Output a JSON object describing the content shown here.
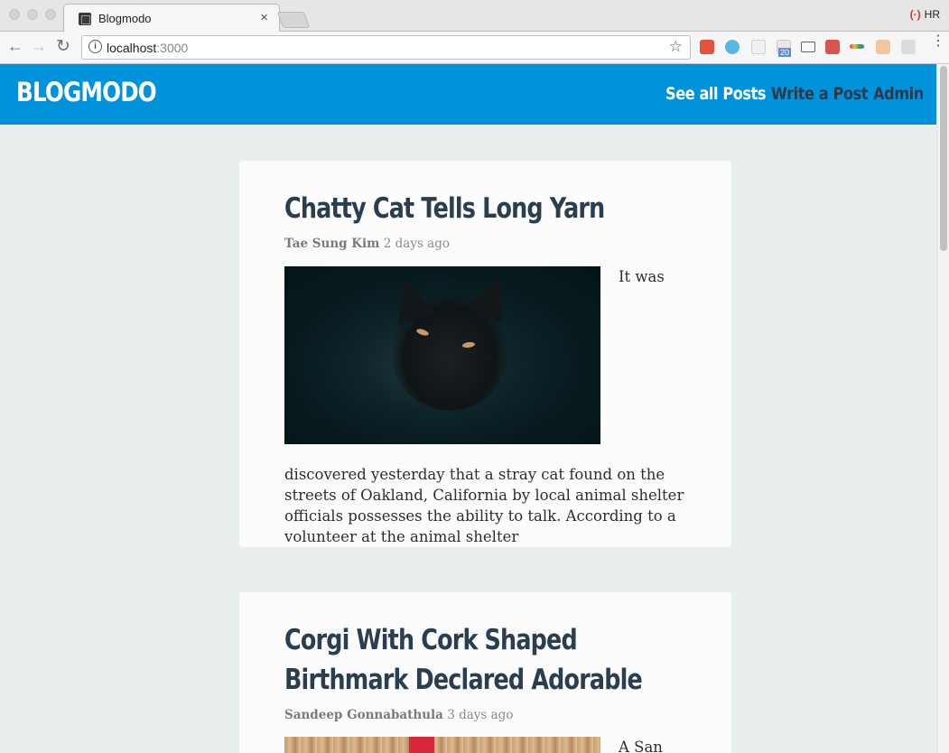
{
  "browser": {
    "tab_title": "Blogmodo",
    "url_host": "localhost",
    "url_port": ":3000",
    "profile_initials": "HR",
    "close_glyph": "×",
    "star_glyph": "☆",
    "back_glyph": "←",
    "forward_glyph": "→",
    "reload_glyph": "↻",
    "menu_glyph": "⋮",
    "info_glyph": "i",
    "extension_badge": "20"
  },
  "site": {
    "brand": "BLOGMODO",
    "nav": [
      {
        "label": "See all Posts",
        "active": true
      },
      {
        "label": "Write a Post",
        "active": false
      },
      {
        "label": "Admin",
        "active": false
      }
    ],
    "colors": {
      "header": "#0092da",
      "title": "#2b3e50",
      "background": "#e9eeef"
    }
  },
  "posts": [
    {
      "title": "Chatty Cat Tells Long Yarn",
      "author": "Tae Sung Kim",
      "time": "2 days ago",
      "excerpt_lead": "It was",
      "excerpt": "discovered yesterday that a stray cat found on the streets of Oakland, California by local animal shelter officials possesses the ability to talk. According to a volunteer at the animal shelter",
      "image": "black-cat-photo"
    },
    {
      "title_line1": "Corgi With Cork Shaped",
      "title_line2": "Birthmark Declared Adorable",
      "author": "Sandeep Gonnabathula",
      "time": "3 days ago",
      "excerpt_lead": "A San",
      "image": "corgi-photo"
    }
  ]
}
